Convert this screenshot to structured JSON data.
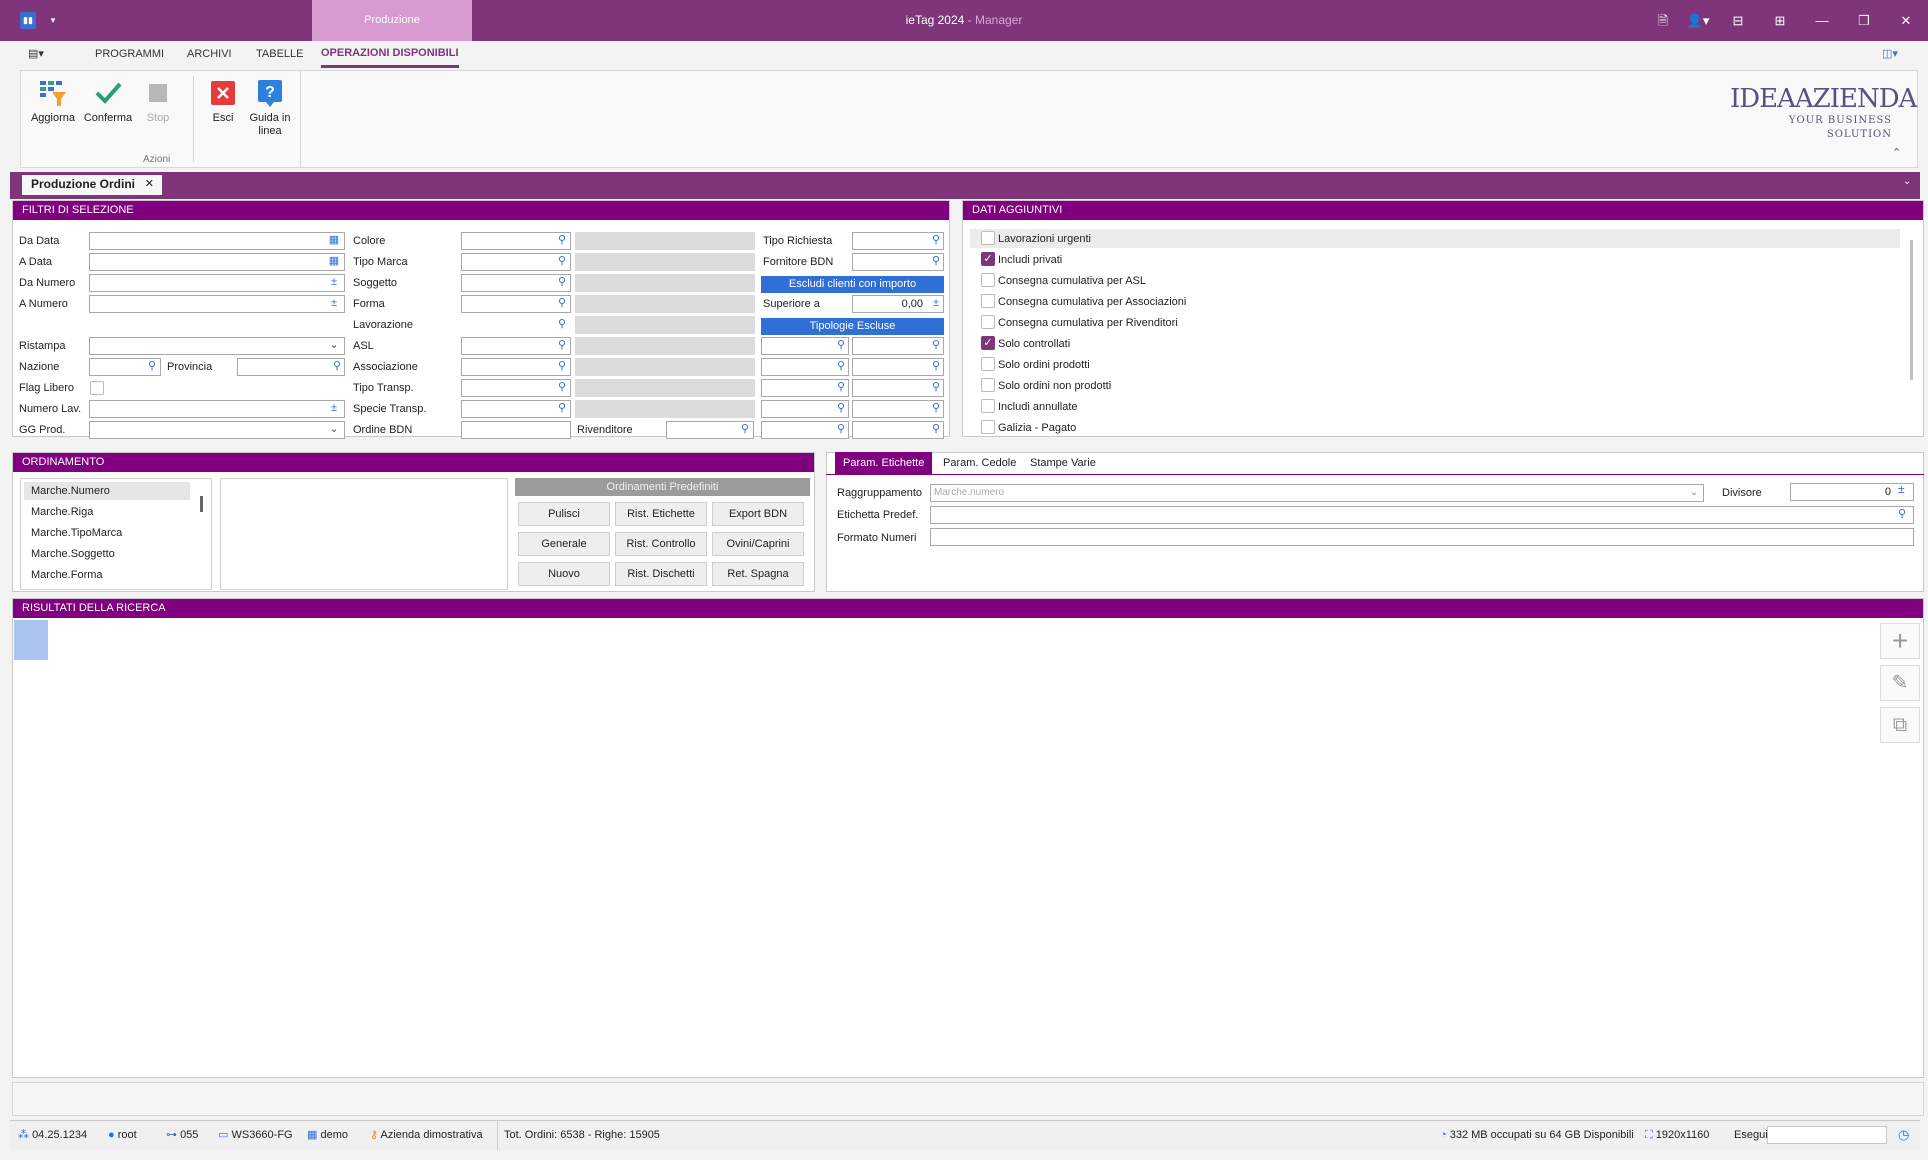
{
  "titlebar": {
    "tab": "Produzione",
    "title": "ieTag 2024",
    "title_sep": " - ",
    "role": "Manager"
  },
  "menu": {
    "items": [
      "PROGRAMMI",
      "ARCHIVI",
      "TABELLE"
    ],
    "active": "OPERAZIONI DISPONIBILI"
  },
  "ribbon": {
    "buttons": [
      {
        "label": "Aggiorna",
        "icon": "refresh-filter-icon"
      },
      {
        "label": "Conferma",
        "icon": "check-icon"
      },
      {
        "label": "Stop",
        "icon": "stop-icon"
      },
      {
        "label": "Esci",
        "icon": "close-icon"
      },
      {
        "label": "Guida in linea",
        "icon": "help-icon"
      }
    ],
    "group_label": "Azioni"
  },
  "logo": {
    "line1": "IDEAAZIENDA",
    "line2": "YOUR BUSINESS SOLUTION"
  },
  "doctab": {
    "label": "Produzione Ordini",
    "close": "✕"
  },
  "filtri": {
    "title": "FILTRI DI SELEZIONE",
    "col1": [
      "Da Data",
      "A Data",
      "Da Numero",
      "A Numero",
      "Ristampa",
      "Nazione",
      "Flag Libero",
      "Numero Lav.",
      "GG Prod."
    ],
    "provincia": "Provincia",
    "col2": [
      "Colore",
      "Tipo Marca",
      "Soggetto",
      "Forma",
      "Lavorazione",
      "ASL",
      "Associazione",
      "Tipo Transp.",
      "Specie Transp.",
      "Ordine BDN"
    ],
    "rivenditore": "Rivenditore",
    "col3": {
      "tipo_richiesta": "Tipo Richiesta",
      "fornitore_bdn": "Fornitore BDN",
      "escludi": "Escludi clienti con importo",
      "superiore": "Superiore a",
      "superiore_val": "0,00",
      "tipologie": "Tipologie Escluse"
    }
  },
  "dati": {
    "title": "DATI AGGIUNTIVI",
    "items": [
      {
        "label": "Lavorazioni urgenti",
        "checked": false
      },
      {
        "label": "Includi privati",
        "checked": true
      },
      {
        "label": "Consegna cumulativa per ASL",
        "checked": false
      },
      {
        "label": "Consegna cumulativa per Associazioni",
        "checked": false
      },
      {
        "label": "Consegna cumulativa per Rivenditori",
        "checked": false
      },
      {
        "label": "Solo controllati",
        "checked": true
      },
      {
        "label": "Solo ordini prodotti",
        "checked": false
      },
      {
        "label": "Solo ordini non prodotti",
        "checked": false
      },
      {
        "label": "Includi annullate",
        "checked": false
      },
      {
        "label": "Galizia - Pagato",
        "checked": false
      }
    ]
  },
  "ordinamento": {
    "title": "ORDINAMENTO",
    "fields": [
      "Marche.Numero",
      "Marche.Riga",
      "Marche.TipoMarca",
      "Marche.Soggetto",
      "Marche.Forma"
    ],
    "predef_title": "Ordinamenti Predefiniti",
    "buttons": [
      "Pulisci",
      "Rist. Etichette",
      "Export BDN",
      "Generale",
      "Rist. Controllo",
      "Ovini/Caprini",
      "Nuovo",
      "Rist. Dischetti",
      "Ret. Spagna"
    ]
  },
  "param": {
    "tabs": [
      "Param. Etichette",
      "Param. Cedole",
      "Stampe Varie"
    ],
    "raggruppamento": "Raggruppamento",
    "raggruppamento_placeholder": "Marche.numero",
    "divisore": "Divisore",
    "divisore_val": "0",
    "etichetta": "Etichetta Predef.",
    "formato": "Formato Numeri"
  },
  "risultati": {
    "title": "RISULTATI DELLA RICERCA"
  },
  "status": {
    "version": "04.25.1234",
    "user": "root",
    "code": "055",
    "workstation": "WS3660-FG",
    "db": "demo",
    "company": "Azienda dimostrativa",
    "totals": "Tot. Ordini: 6538 - Righe: 15905",
    "memory": "332 MB occupati su 64 GB Disponibili",
    "resolution": "1920x1160",
    "run_label": "Esegui"
  },
  "colors": {
    "brand": "#7e3579",
    "panel_head": "#800080",
    "blue_button": "#2f6fd6"
  }
}
